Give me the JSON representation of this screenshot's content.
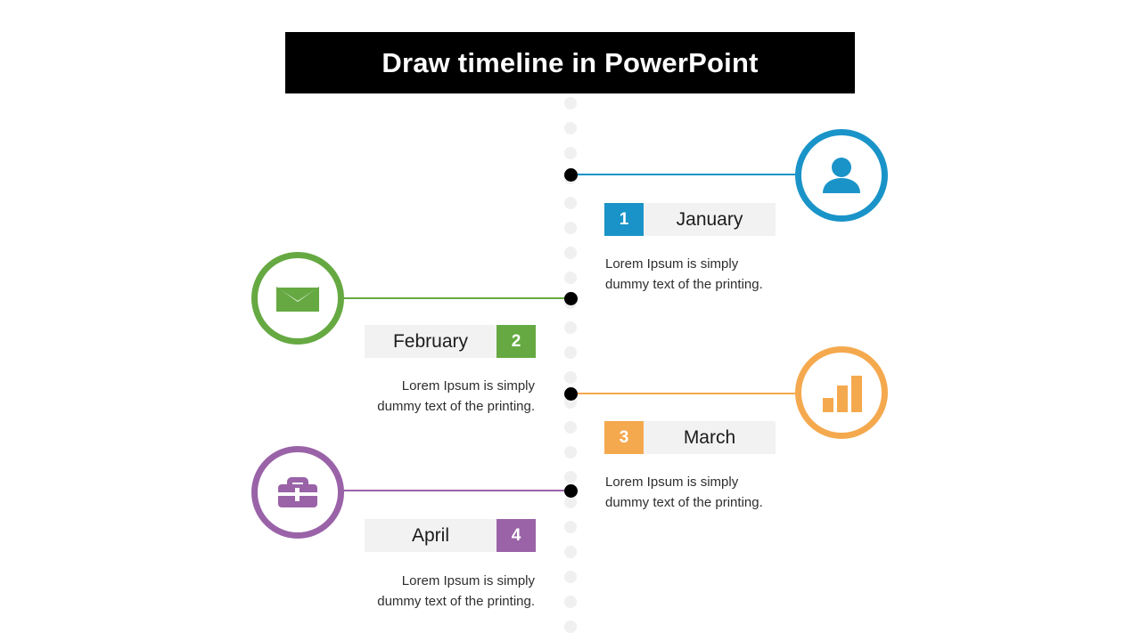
{
  "header": {
    "title": "Draw timeline in PowerPoint",
    "background": "#000000",
    "text_color": "#ffffff"
  },
  "timeline": {
    "spine_dot_color": "#f0f0f0",
    "node_dot_color": "#000000",
    "milestones": [
      {
        "number": "1",
        "month": "January",
        "description": "Lorem Ipsum is simply\ndummy text of the printing.",
        "color": "#1a94c8",
        "icon": "person-icon",
        "side": "right"
      },
      {
        "number": "2",
        "month": "February",
        "description": "Lorem Ipsum is simply\ndummy text of the printing.",
        "color": "#66a942",
        "icon": "envelope-icon",
        "side": "left"
      },
      {
        "number": "3",
        "month": "March",
        "description": "Lorem Ipsum is simply\ndummy text of the printing.",
        "color": "#f5a94e",
        "icon": "bar-chart-icon",
        "side": "right"
      },
      {
        "number": "4",
        "month": "April",
        "description": "Lorem Ipsum is simply\ndummy text of the printing.",
        "color": "#9a63a8",
        "icon": "briefcase-icon",
        "side": "left"
      }
    ]
  }
}
